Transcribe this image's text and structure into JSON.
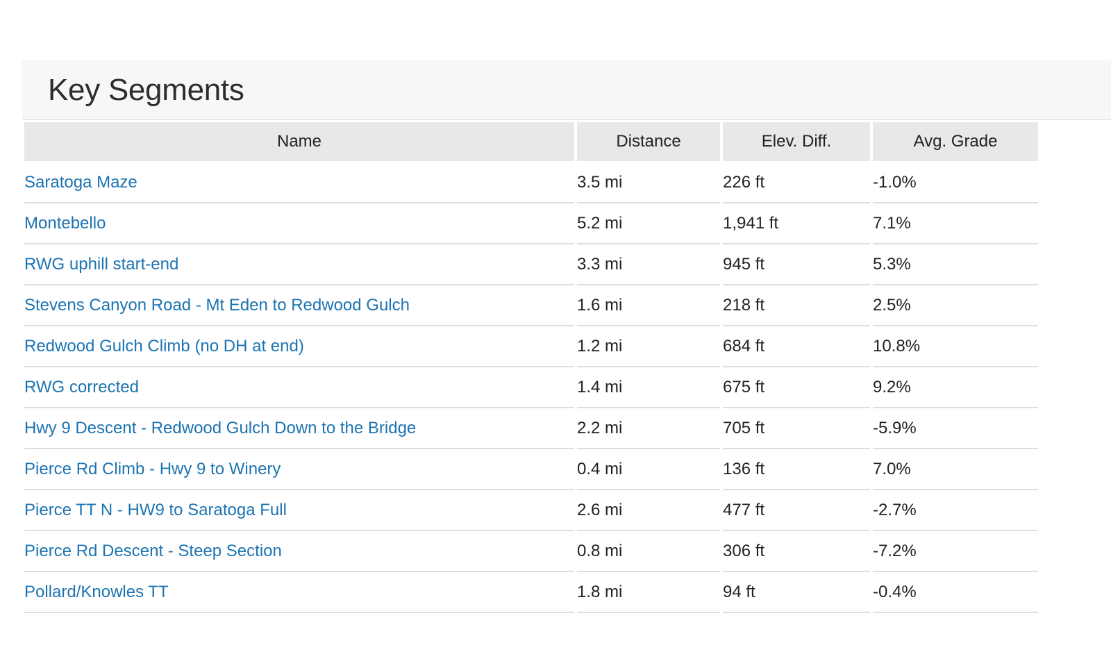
{
  "panel": {
    "title": "Key Segments"
  },
  "table": {
    "headers": {
      "name": "Name",
      "distance": "Distance",
      "elev_diff": "Elev. Diff.",
      "avg_grade": "Avg. Grade"
    },
    "rows": [
      {
        "name": "Saratoga Maze",
        "distance": "3.5 mi",
        "elev_diff": "226 ft",
        "avg_grade": "-1.0%"
      },
      {
        "name": "Montebello",
        "distance": "5.2 mi",
        "elev_diff": "1,941 ft",
        "avg_grade": "7.1%"
      },
      {
        "name": "RWG uphill start-end",
        "distance": "3.3 mi",
        "elev_diff": "945 ft",
        "avg_grade": "5.3%"
      },
      {
        "name": "Stevens Canyon Road - Mt Eden to Redwood Gulch",
        "distance": "1.6 mi",
        "elev_diff": "218 ft",
        "avg_grade": "2.5%"
      },
      {
        "name": "Redwood Gulch Climb (no DH at end)",
        "distance": "1.2 mi",
        "elev_diff": "684 ft",
        "avg_grade": "10.8%"
      },
      {
        "name": "RWG corrected",
        "distance": "1.4 mi",
        "elev_diff": "675 ft",
        "avg_grade": "9.2%"
      },
      {
        "name": "Hwy 9 Descent - Redwood Gulch Down to the Bridge",
        "distance": "2.2 mi",
        "elev_diff": "705 ft",
        "avg_grade": "-5.9%"
      },
      {
        "name": "Pierce Rd Climb - Hwy 9 to Winery",
        "distance": "0.4 mi",
        "elev_diff": "136 ft",
        "avg_grade": "7.0%"
      },
      {
        "name": "Pierce TT N - HW9 to Saratoga Full",
        "distance": "2.6 mi",
        "elev_diff": "477 ft",
        "avg_grade": "-2.7%"
      },
      {
        "name": "Pierce Rd Descent - Steep Section",
        "distance": "0.8 mi",
        "elev_diff": "306 ft",
        "avg_grade": "-7.2%"
      },
      {
        "name": "Pollard/Knowles TT",
        "distance": "1.8 mi",
        "elev_diff": "94 ft",
        "avg_grade": "-0.4%"
      }
    ]
  },
  "colors": {
    "link": "#1c74b2",
    "header_bg": "#e8e8e8",
    "panel_header_bg": "#f7f7f7",
    "row_border": "#dddddd"
  }
}
